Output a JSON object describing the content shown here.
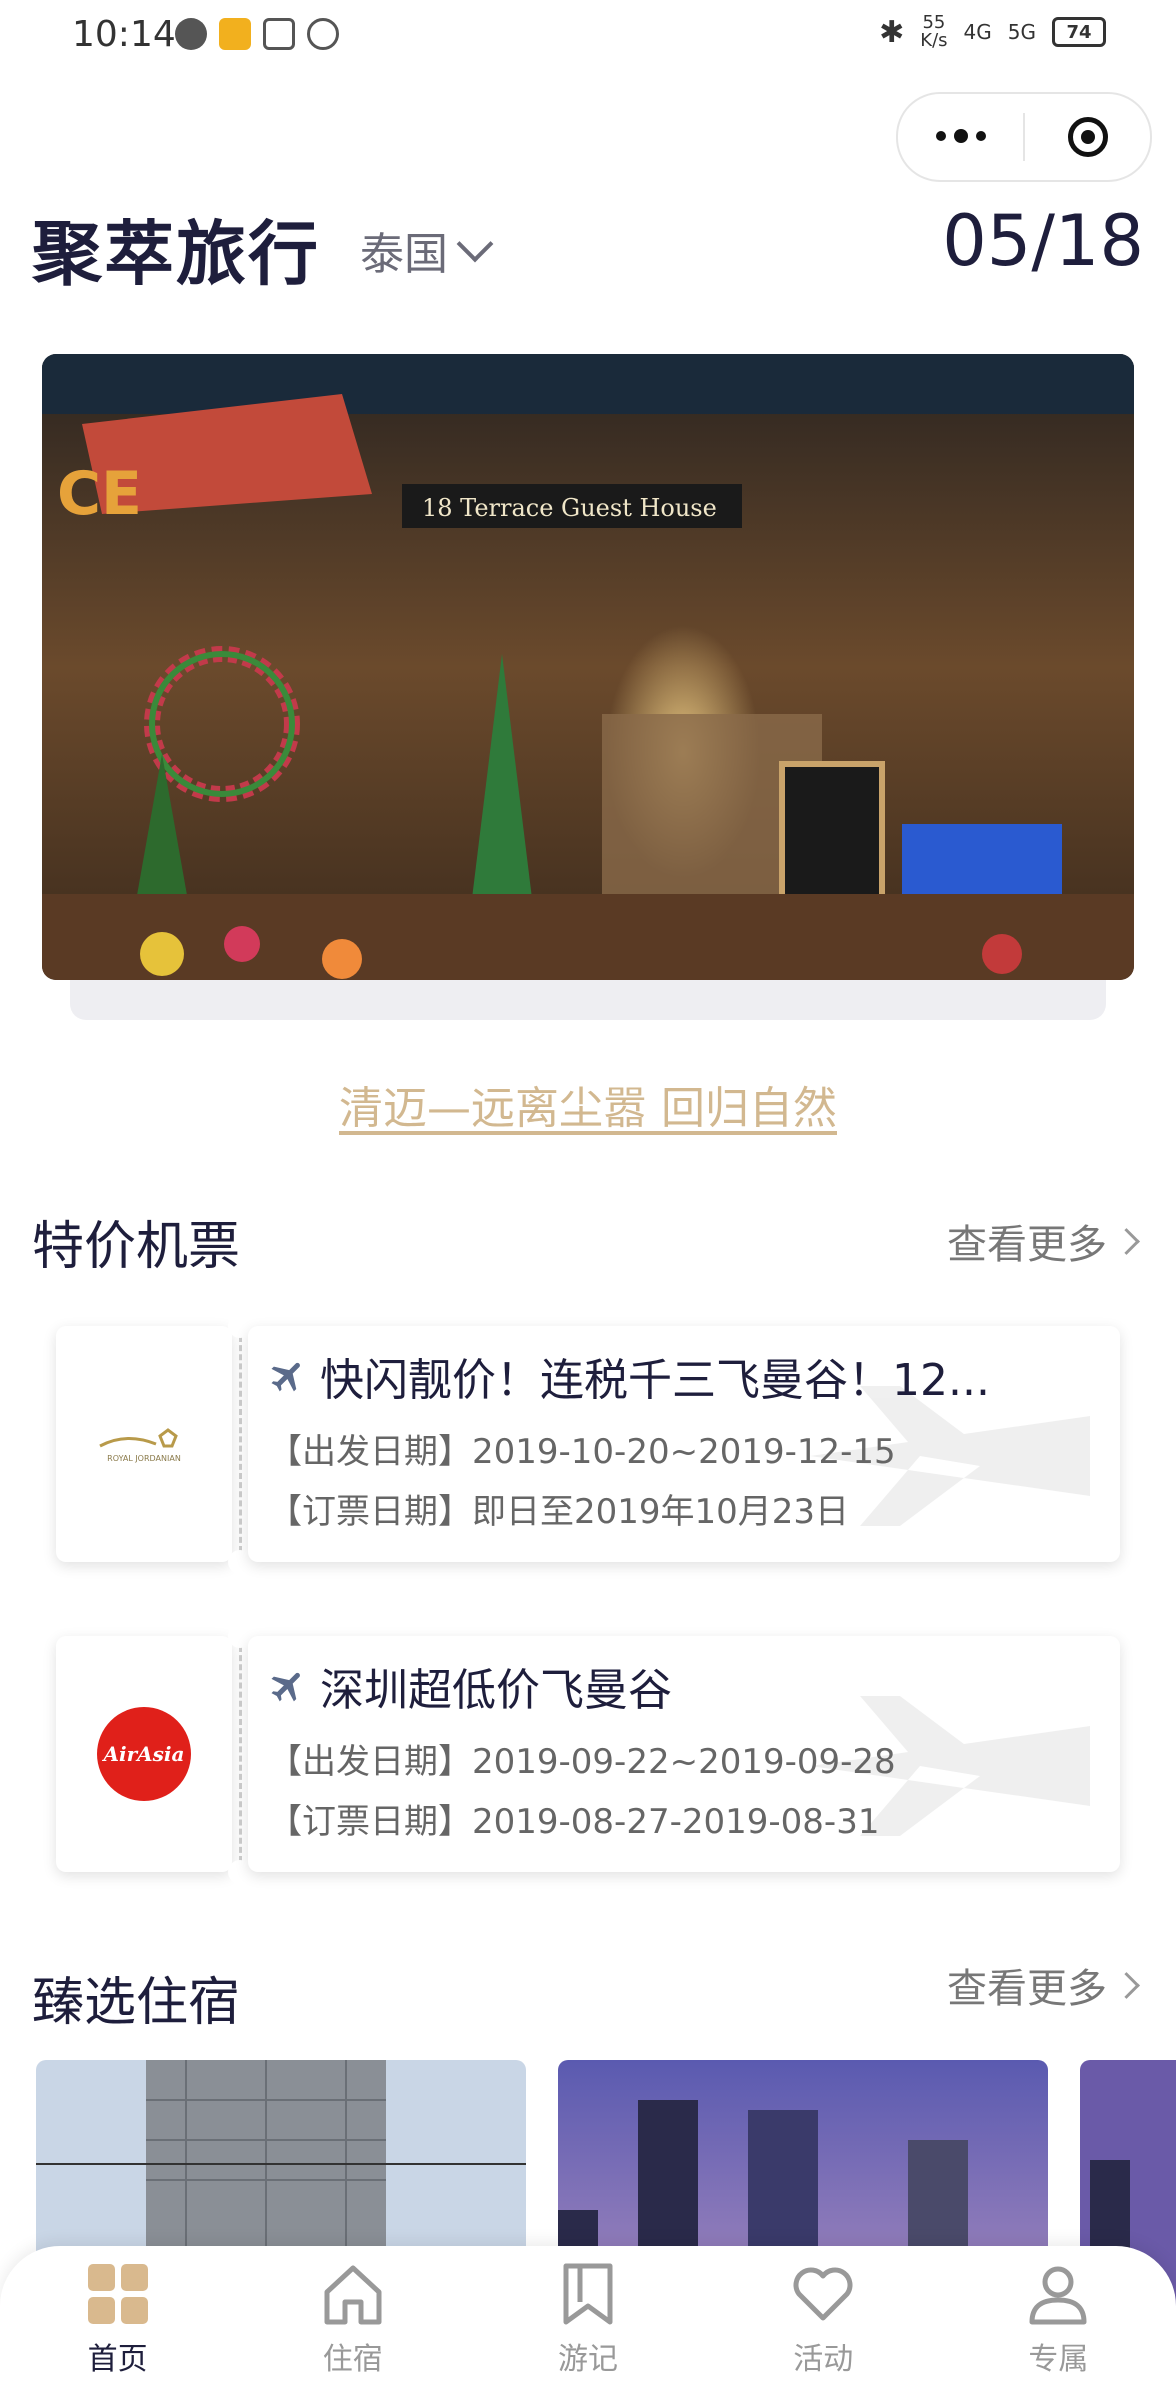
{
  "status_bar": {
    "time": "10:14",
    "net_speed_value": "55",
    "net_speed_unit": "K/s",
    "signal_1": "4G",
    "signal_2": "5G",
    "battery": "74"
  },
  "header": {
    "brand": "聚萃旅行",
    "country": "泰国",
    "date": "05/18"
  },
  "banner": {
    "caption": "清迈—远离尘嚣 回归自然",
    "slides_total": 4,
    "active_slide": 2
  },
  "flights_section": {
    "title": "特价机票",
    "more_label": "查看更多",
    "items": [
      {
        "title": "快闪靓价！连税千三飞曼谷！12...",
        "depart": "【出发日期】2019-10-20~2019-12-15",
        "book": "【订票日期】即日至2019年10月23日",
        "logo": "royal-jordanian-logo"
      },
      {
        "title": "深圳超低价飞曼谷",
        "depart": "【出发日期】2019-09-22~2019-09-28",
        "book": "【订票日期】2019-08-27-2019-08-31",
        "logo": "airasia-logo"
      }
    ]
  },
  "logos": {
    "airasia_text": "AirAsia",
    "royal_text": "ROYAL JORDANIAN"
  },
  "hotels_section": {
    "title": "臻选住宿",
    "more_label": "查看更多"
  },
  "tabbar": {
    "tabs": [
      {
        "label": "首页",
        "icon": "home-grid-icon",
        "active": true
      },
      {
        "label": "住宿",
        "icon": "house-icon",
        "active": false
      },
      {
        "label": "游记",
        "icon": "bookmark-icon",
        "active": false
      },
      {
        "label": "活动",
        "icon": "heart-icon",
        "active": false
      },
      {
        "label": "专属",
        "icon": "user-icon",
        "active": false
      }
    ]
  },
  "colors": {
    "primary": "#1e1e3c",
    "accent_gold": "#d2b890",
    "muted": "#999999"
  }
}
